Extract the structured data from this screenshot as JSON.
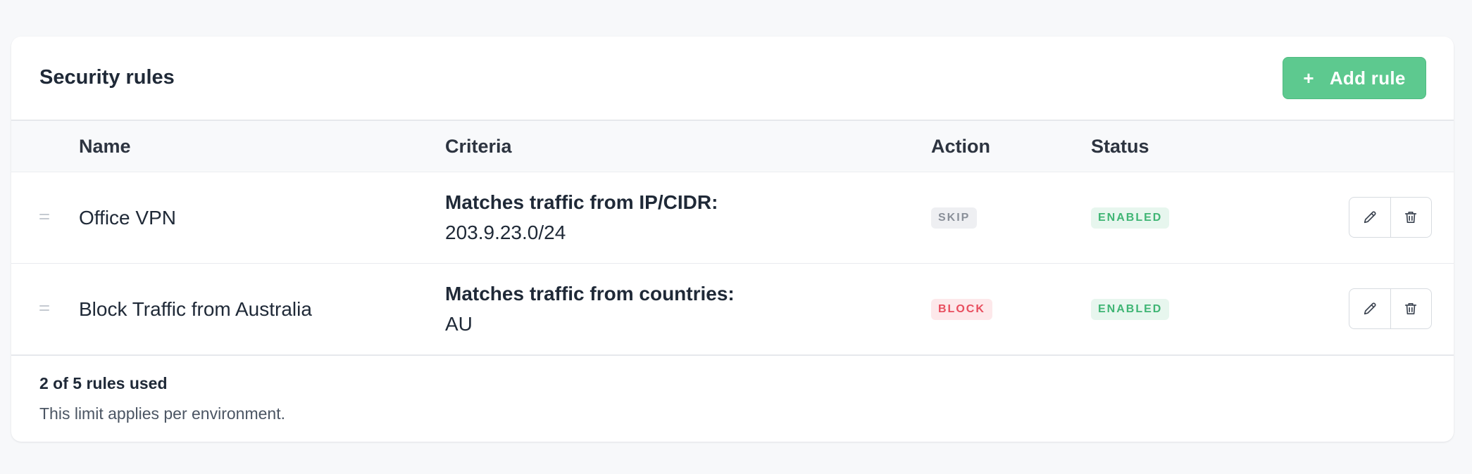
{
  "card": {
    "title": "Security rules",
    "add_button": {
      "icon": "plus-icon",
      "label": "Add rule"
    }
  },
  "table": {
    "columns": [
      "Name",
      "Criteria",
      "Action",
      "Status"
    ],
    "rows": [
      {
        "name": "Office VPN",
        "criteria_title": "Matches traffic from IP/CIDR:",
        "criteria_value": "203.9.23.0/24",
        "action": "SKIP",
        "status": "ENABLED"
      },
      {
        "name": "Block Traffic from Australia",
        "criteria_title": "Matches traffic from countries:",
        "criteria_value": "AU",
        "action": "BLOCK",
        "status": "ENABLED"
      }
    ]
  },
  "footer": {
    "usage": "2 of 5 rules used",
    "note": "This limit applies per environment."
  },
  "colors": {
    "accent": "#5dc98f",
    "enabled": "#3fb574",
    "block": "#e84e5e",
    "skip": "#8a9099"
  }
}
